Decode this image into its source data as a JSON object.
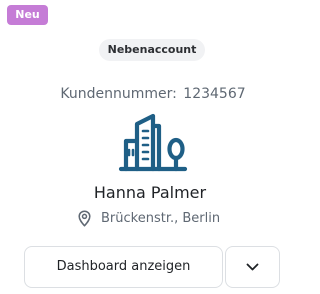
{
  "colors": {
    "new_badge_bg": "#c57cd6",
    "icon_accent": "#1f5f86",
    "text_primary": "#1f2226",
    "text_secondary": "#5f6873"
  },
  "card": {
    "new_badge": "Neu",
    "account_type": "Nebenaccount",
    "customer_number_label": "Kundennummer:",
    "customer_number": "1234567",
    "icon": "building-icon",
    "customer_name": "Hanna Palmer",
    "location_icon": "map-pin-icon",
    "location": "Brückenstr., Berlin"
  },
  "actions": {
    "dashboard_label": "Dashboard anzeigen",
    "dropdown_icon": "chevron-down-icon"
  }
}
